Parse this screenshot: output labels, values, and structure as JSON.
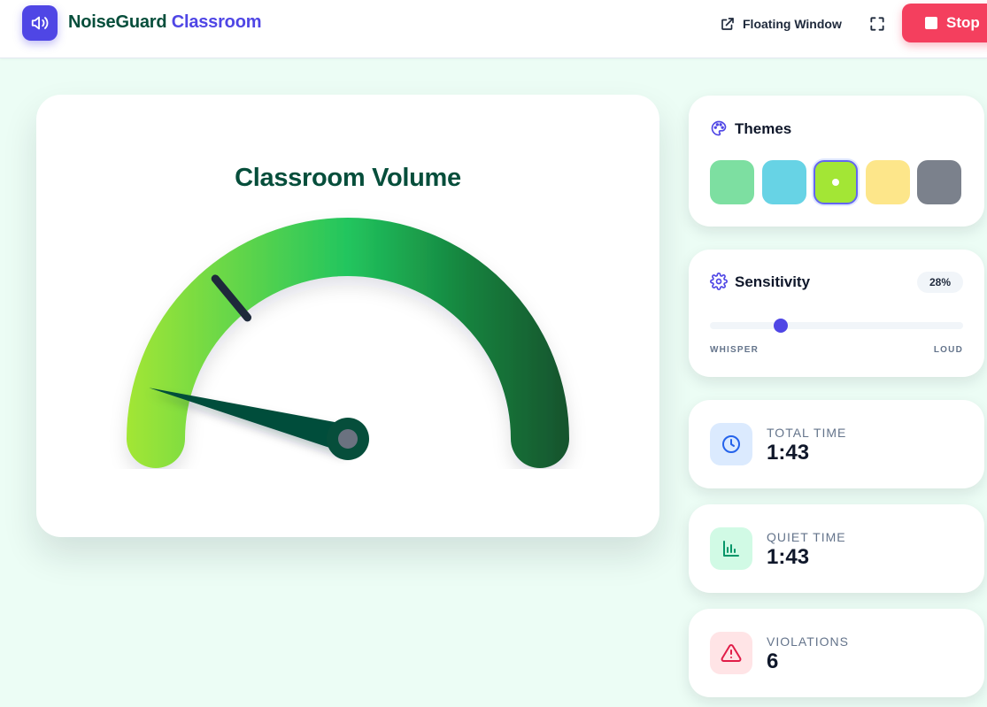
{
  "header": {
    "brand_part1": "NoiseGuard",
    "brand_part2": "Classroom",
    "floating_window_label": "Floating Window",
    "stop_label": "Stop"
  },
  "gauge": {
    "title": "Classroom Volume",
    "level_percent": 8,
    "threshold_percent": 28
  },
  "themes": {
    "title": "Themes",
    "swatches": [
      {
        "color": "#7ddfa1",
        "active": false
      },
      {
        "color": "#67d3e5",
        "active": false
      },
      {
        "color": "#a3e635",
        "active": true
      },
      {
        "color": "#fde68a",
        "active": false
      },
      {
        "color": "#7b818c",
        "active": false
      }
    ]
  },
  "sensitivity": {
    "title": "Sensitivity",
    "value_label": "28%",
    "value": 28,
    "min_label": "WHISPER",
    "max_label": "LOUD"
  },
  "stats": {
    "total_time": {
      "label": "TOTAL TIME",
      "value": "1:43",
      "icon": "clock-icon",
      "bg": "#dbeafe",
      "color": "#2563eb"
    },
    "quiet_time": {
      "label": "QUIET TIME",
      "value": "1:43",
      "icon": "bar-chart-icon",
      "bg": "#d1fae5",
      "color": "#059669"
    },
    "violations": {
      "label": "VIOLATIONS",
      "value": "6",
      "icon": "alert-triangle-icon",
      "bg": "#ffe4e6",
      "color": "#e11d48"
    }
  },
  "colors": {
    "accent": "#4f46e5",
    "brand_dark": "#064e3b",
    "stop": "#f43f5e"
  }
}
